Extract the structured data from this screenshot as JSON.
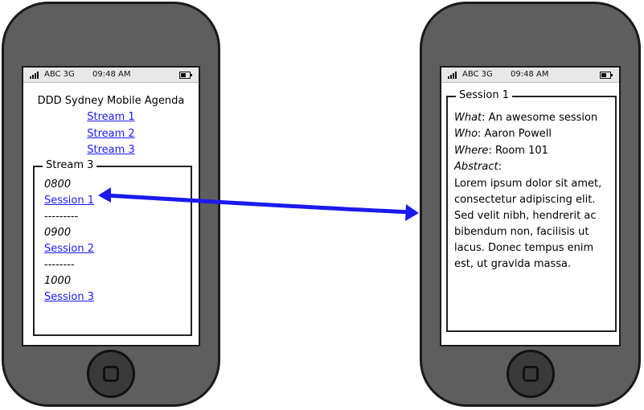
{
  "status_bar": {
    "carrier": "ABC 3G",
    "time": "09:48 AM"
  },
  "left_screen": {
    "title": "DDD Sydney Mobile Agenda",
    "stream_links": [
      "Stream 1",
      "Stream 2",
      "Stream 3"
    ],
    "stream_panel": {
      "legend": "Stream 3",
      "time_0800": "0800",
      "session_1": "Session 1",
      "divider_1": "---------",
      "time_0900": "0900",
      "session_2": "Session 2",
      "divider_2": "--------",
      "time_1000": "1000",
      "session_3": "Session 3"
    }
  },
  "right_screen": {
    "legend": "Session 1",
    "what_label": "What",
    "what_value": ": An awesome session",
    "who_label": "Who",
    "who_value": ": Aaron Powell",
    "where_label": "Where",
    "where_value": ": Room 101",
    "abstract_label": "Abstract",
    "abstract_suffix": ":",
    "abstract_text": "Lorem ipsum dolor sit amet, consectetur adipiscing elit. Sed velit nibh, hendrerit ac bibendum non, facilisis ut lacus. Donec tempus enim est, ut gravida massa."
  },
  "colors": {
    "link": "#1a1aff",
    "arrow": "#1a1aee",
    "phone_body": "#5e5e5e"
  }
}
